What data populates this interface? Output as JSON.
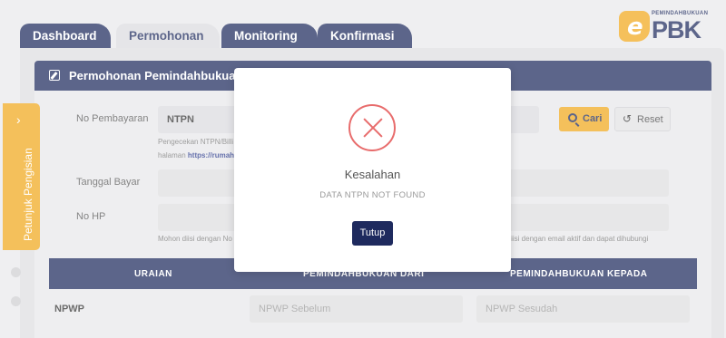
{
  "tabs": [
    "Dashboard",
    "Permohonan",
    "Monitoring",
    "Konfirmasi"
  ],
  "logo": {
    "tagline": "PEMINDAHBUKUAN",
    "letter": "e",
    "brand": "PBK"
  },
  "form": {
    "header": "Permohonan Pemindahbukuan",
    "payment_label": "No Pembayaran",
    "payment_type": "NTPN",
    "hint_line1": "Pengecekan NTPN/Billi",
    "hint_line2_prefix": "halaman ",
    "hint_link": "https://rumah",
    "date_label": "Tanggal Bayar",
    "phone_label": "No HP",
    "phone_hint": "Mohon diisi dengan No",
    "email_hint": "n diisi dengan email aktif dan dapat dihubungi",
    "search_button": "Cari",
    "reset_button": "Reset"
  },
  "table": {
    "headers": [
      "URAIAN",
      "PEMINDAHBUKUAN DARI",
      "PEMINDAHBUKUAN KEPADA"
    ],
    "rows": [
      {
        "label": "NPWP",
        "from_placeholder": "NPWP Sebelum",
        "to_placeholder": "NPWP Sesudah"
      }
    ]
  },
  "side_panel": {
    "label": "Petunjuk Pengisian",
    "chevron": "›"
  },
  "modal": {
    "title": "Kesalahan",
    "message": "DATA NTPN NOT FOUND",
    "close_button": "Tutup"
  },
  "colors": {
    "navy": "#1e2a5e",
    "accent": "#f0a81d",
    "error": "#e86c6c"
  }
}
